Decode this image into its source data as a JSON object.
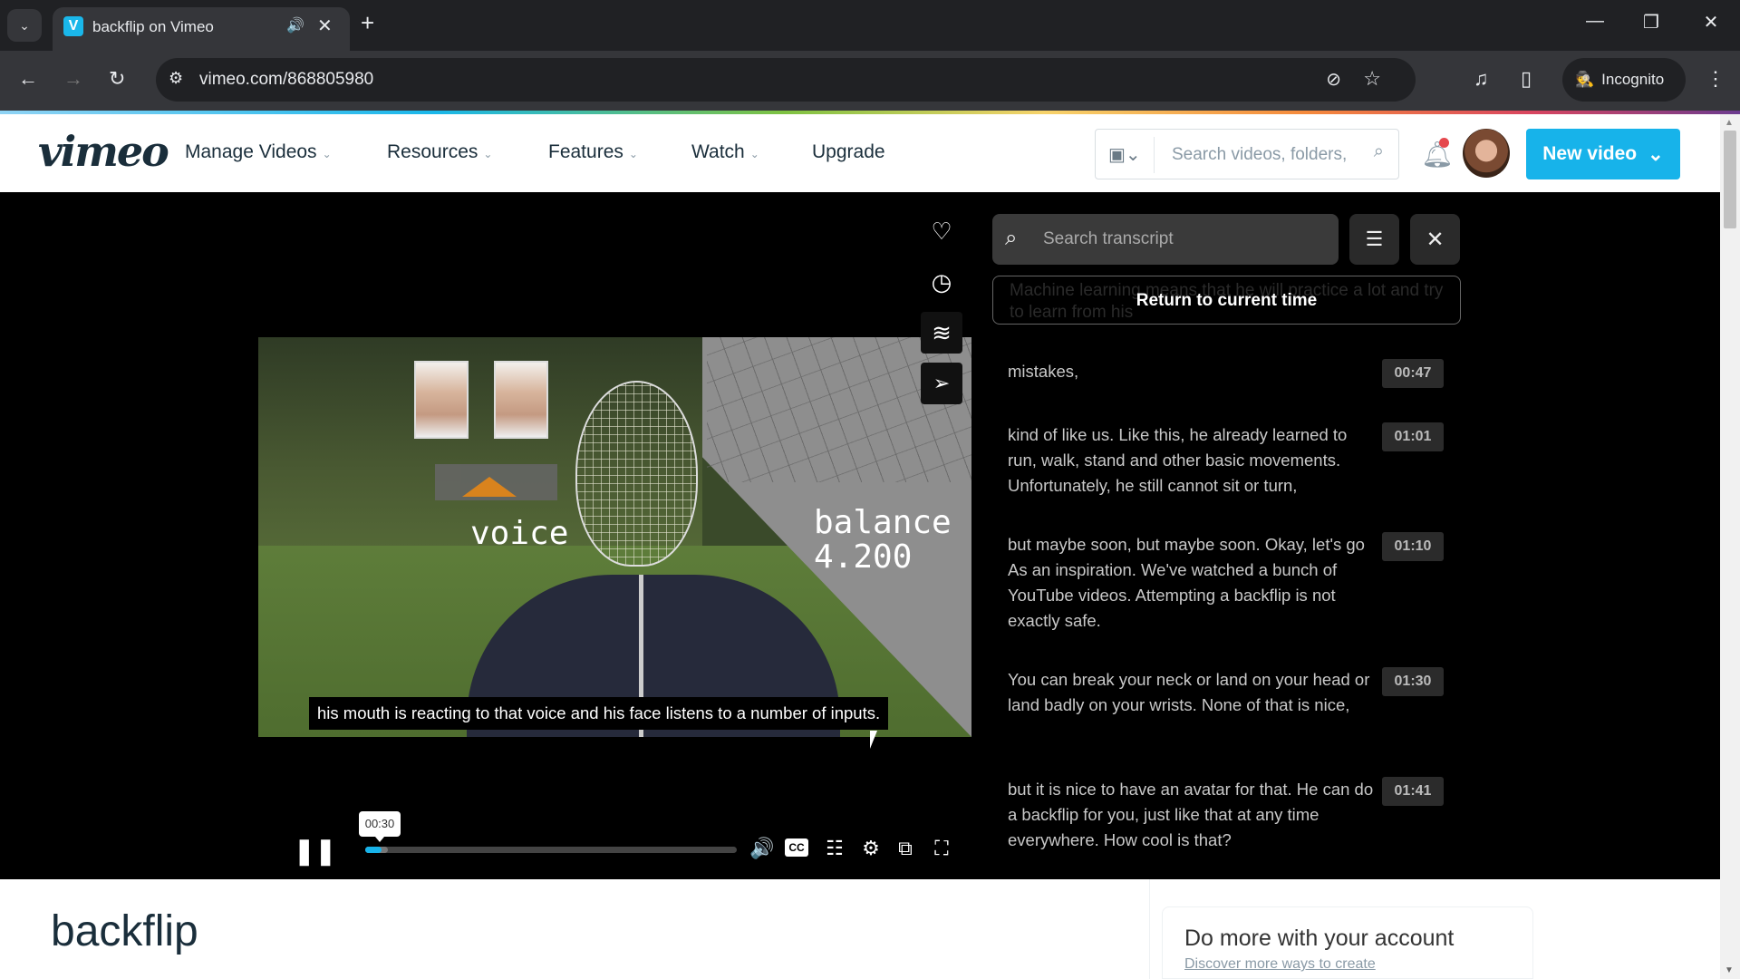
{
  "browser": {
    "tab_title": "backflip on Vimeo",
    "favicon": "V",
    "url": "vimeo.com/868805980",
    "profile_label": "Incognito",
    "icons": {
      "tab_list": "⌄",
      "audio": "🔊",
      "close": "✕",
      "new_tab": "+",
      "minimize": "—",
      "restore": "❐",
      "window_close": "✕",
      "back": "←",
      "forward": "→",
      "reload": "↻",
      "site_settings": "⚙",
      "eye_off": "⊘",
      "star": "☆",
      "media": "♫",
      "sidepanel": "▯",
      "menu": "⋮",
      "incognito": "🕵"
    }
  },
  "header": {
    "logo": "vimeo",
    "nav": [
      {
        "label": "Manage Videos",
        "has_dropdown": true
      },
      {
        "label": "Resources",
        "has_dropdown": true
      },
      {
        "label": "Features",
        "has_dropdown": true
      },
      {
        "label": "Watch",
        "has_dropdown": true
      },
      {
        "label": "Upgrade",
        "has_dropdown": false
      }
    ],
    "chevron": "⌄",
    "search_placeholder": "Search videos, folders,",
    "new_video_label": "New video",
    "notification_badge_color": "#e5484d",
    "accent_color": "#17b3ea"
  },
  "player": {
    "side_actions": [
      {
        "name": "like",
        "glyph": "♡"
      },
      {
        "name": "watch-later",
        "glyph": "◷"
      },
      {
        "name": "collections",
        "glyph": "≋"
      },
      {
        "name": "share",
        "glyph": "➢"
      }
    ],
    "overlay_voice": "voice",
    "overlay_balance": "balance",
    "overlay_balance_value": "4.200",
    "caption": "his mouth is reacting to that voice and his face listens to a number of inputs.",
    "current_time": "00:30",
    "progress_fraction": 0.045,
    "controls": {
      "pause": "❚❚",
      "volume": "🔊",
      "cc": "CC",
      "transcript": "☷",
      "settings": "⚙",
      "pip": "⧉",
      "fullscreen": "⛶"
    }
  },
  "transcript": {
    "search_placeholder": "Search transcript",
    "filter_glyph": "☰",
    "close_glyph": "✕",
    "search_glyph": "⌕",
    "return_label": "Return to current time",
    "ghost_text": "Machine learning means that he will practice a lot and try to learn from his",
    "entries": [
      {
        "text": "mistakes,",
        "time": "00:47"
      },
      {
        "text": "kind of like us. Like this, he already learned to run, walk, stand and other basic movements. Unfortunately, he still cannot sit or turn,",
        "time": "01:01"
      },
      {
        "text": "but maybe soon, but maybe soon. Okay, let's go As an inspiration. We've watched a bunch of YouTube videos. Attempting a backflip is not exactly safe.",
        "time": "01:10"
      },
      {
        "text": "You can break your neck or land on your head or land badly on your wrists. None of that is nice,",
        "time": "01:30"
      },
      {
        "text": "but it is nice to have an avatar for that. He can do a backflip for you, just like that at any time everywhere. How cool is that?",
        "time": "01:41"
      }
    ]
  },
  "below": {
    "video_title": "backflip",
    "promo_heading": "Do more with your account",
    "promo_link": "Discover more ways to create"
  }
}
